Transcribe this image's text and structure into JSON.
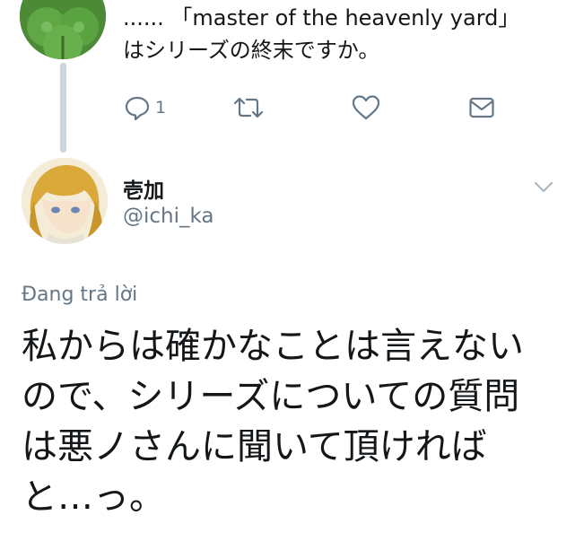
{
  "parent_tweet": {
    "text_lines": [
      "...... 「master of the heavenly yard」",
      "はシリーズの終末ですか。"
    ],
    "reply_count": "1",
    "avatar_icon": "clover-avatar"
  },
  "actions": {
    "reply_icon": "reply-icon",
    "retweet_icon": "retweet-icon",
    "like_icon": "heart-icon",
    "dm_icon": "envelope-icon"
  },
  "tweet": {
    "display_name": "壱加",
    "handle": "@ichi_ka",
    "replying_label": "Đang trả lời",
    "text_lines": [
      "私からは確かなことは言えない",
      "ので、シリーズについての質問",
      "は悪ノさんに聞いて頂ければ",
      "と…っ。"
    ]
  },
  "colors": {
    "text": "#14171a",
    "secondary": "#657786",
    "thread_line": "#ccd6dd"
  }
}
